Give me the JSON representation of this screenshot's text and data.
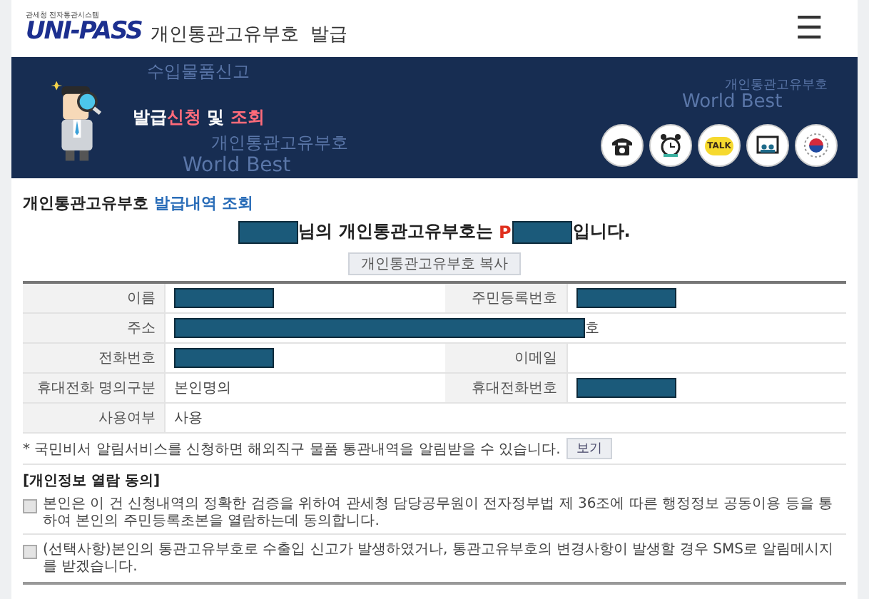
{
  "header": {
    "logo_caption": "관세청 전자통관시스템",
    "logo_text": "UNI-PASS",
    "title": "개인통관고유부호  발급",
    "menu_icon": "☰"
  },
  "banner": {
    "background_words": [
      "수입물품신고",
      "개인통관고유부호",
      "World Best",
      "개인통관고유부호",
      "World Best"
    ],
    "heading": [
      {
        "text": "발급",
        "accent": false
      },
      {
        "text": "신청",
        "accent": true
      },
      {
        "text": " 및 ",
        "accent": false
      },
      {
        "text": "조회",
        "accent": true
      }
    ],
    "quick_icons": [
      {
        "kind": "phone"
      },
      {
        "kind": "clock"
      },
      {
        "kind": "talk",
        "text": "TALK"
      },
      {
        "kind": "board"
      },
      {
        "kind": "emblem"
      }
    ]
  },
  "section_title": {
    "text": "개인통관고유부호",
    "accent": "발급내역 조회"
  },
  "result": [
    {
      "kind": "redacted"
    },
    {
      "kind": "text",
      "text": "님의 개인통관고유부호는 "
    },
    {
      "kind": "code",
      "text": "P"
    },
    {
      "kind": "redacted"
    },
    {
      "kind": "text",
      "text": "입니다."
    }
  ],
  "copy_button": "개인통관고유부호 복사",
  "table": {
    "rows": [
      [
        {
          "label": "이름",
          "value": [
            {
              "kind": "redacted"
            }
          ]
        },
        {
          "label": "주민등록번호",
          "value": [
            {
              "kind": "redacted"
            }
          ]
        }
      ],
      [
        {
          "label": "주소",
          "value": [
            {
              "kind": "redacted",
              "wide": true
            },
            {
              "kind": "text",
              "text": "호"
            }
          ]
        }
      ],
      [
        {
          "label": "전화번호",
          "value": [
            {
              "kind": "redacted"
            }
          ]
        },
        {
          "label": "이메일"
        }
      ],
      [
        {
          "label": "휴대전화 명의구분",
          "value": [
            {
              "kind": "text",
              "text": "본인명의"
            }
          ]
        },
        {
          "label": "휴대전화번호",
          "value": [
            {
              "kind": "redacted"
            }
          ]
        }
      ],
      [
        {
          "label": "사용여부",
          "value": [
            {
              "kind": "text",
              "text": "사용"
            }
          ]
        }
      ]
    ]
  },
  "notice": {
    "text": "* 국민비서 알림서비스를 신청하면 해외직구 물품 통관내역을 알림받을 수 있습니다.",
    "button": "보기"
  },
  "consent": {
    "heading": "[개인정보 열람 동의]",
    "items": [
      {
        "text": "본인은 이 건 신청내역의 정확한 검증을 위하여 관세청 담당공무원이 전자정부법 제 36조에 따른 행정정보 공동이용 등을 통하여 본인의 주민등록초본을 열람하는데 동의합니다.",
        "checked": false
      },
      {
        "text": "(선택사항)본인의 통관고유부호로 수출입 신고가 발생하였거나, 통관고유부호의 변경사항이 발생할 경우 SMS로 알림메시지를 받겠습니다.",
        "checked": false
      }
    ]
  }
}
